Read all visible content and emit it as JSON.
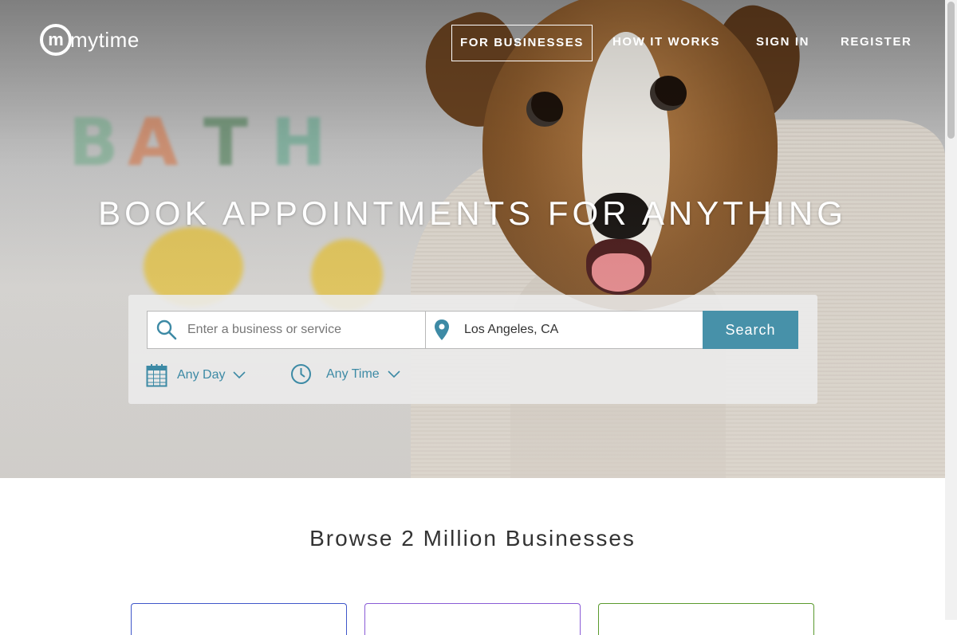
{
  "brand": {
    "logo_text": "mytime"
  },
  "nav": {
    "for_businesses": "FOR BUSINESSES",
    "how_it_works": "HOW IT WORKS",
    "sign_in": "SIGN IN",
    "register": "REGISTER"
  },
  "hero": {
    "headline": "BOOK APPOINTMENTS FOR ANYTHING",
    "background_letters": [
      "B",
      "A",
      "T",
      "H"
    ]
  },
  "search": {
    "service_placeholder": "Enter a business or service",
    "service_value": "",
    "location_value": "Los Angeles, CA",
    "button_label": "Search",
    "day_filter": "Any Day",
    "time_filter": "Any Time"
  },
  "browse": {
    "title": "Browse 2 Million Businesses",
    "card_colors": [
      "#3f57c9",
      "#8a5bd6",
      "#5a9a2e"
    ]
  },
  "colors": {
    "accent": "#4791a9",
    "filter_text": "#3d8aa5"
  },
  "icons": {
    "service": "search-icon",
    "location": "map-pin-icon",
    "day": "calendar-icon",
    "time": "clock-icon",
    "dropdown": "chevron-down-icon"
  }
}
